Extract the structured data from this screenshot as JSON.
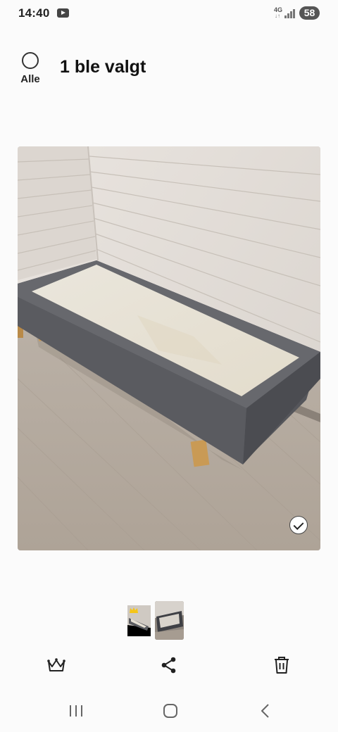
{
  "status_bar": {
    "time": "14:40",
    "network": "4G",
    "battery": "58",
    "notification_icon": "youtube-icon"
  },
  "header": {
    "select_all_label": "Alle",
    "selection_title": "1 ble valgt"
  },
  "photo": {
    "selected": true,
    "subject": "photo-bed-frame"
  },
  "thumbnails": {
    "count": 2,
    "cover_icon": "crown-icon"
  },
  "actions": {
    "icons": [
      "crown-icon",
      "share-icon",
      "trash-icon"
    ]
  },
  "nav_bar": {
    "icons": [
      "recent-apps-icon",
      "home-icon",
      "back-icon"
    ]
  },
  "colors": {
    "background": "#fbfbfb",
    "text": "#111111",
    "badge": "#555555"
  }
}
